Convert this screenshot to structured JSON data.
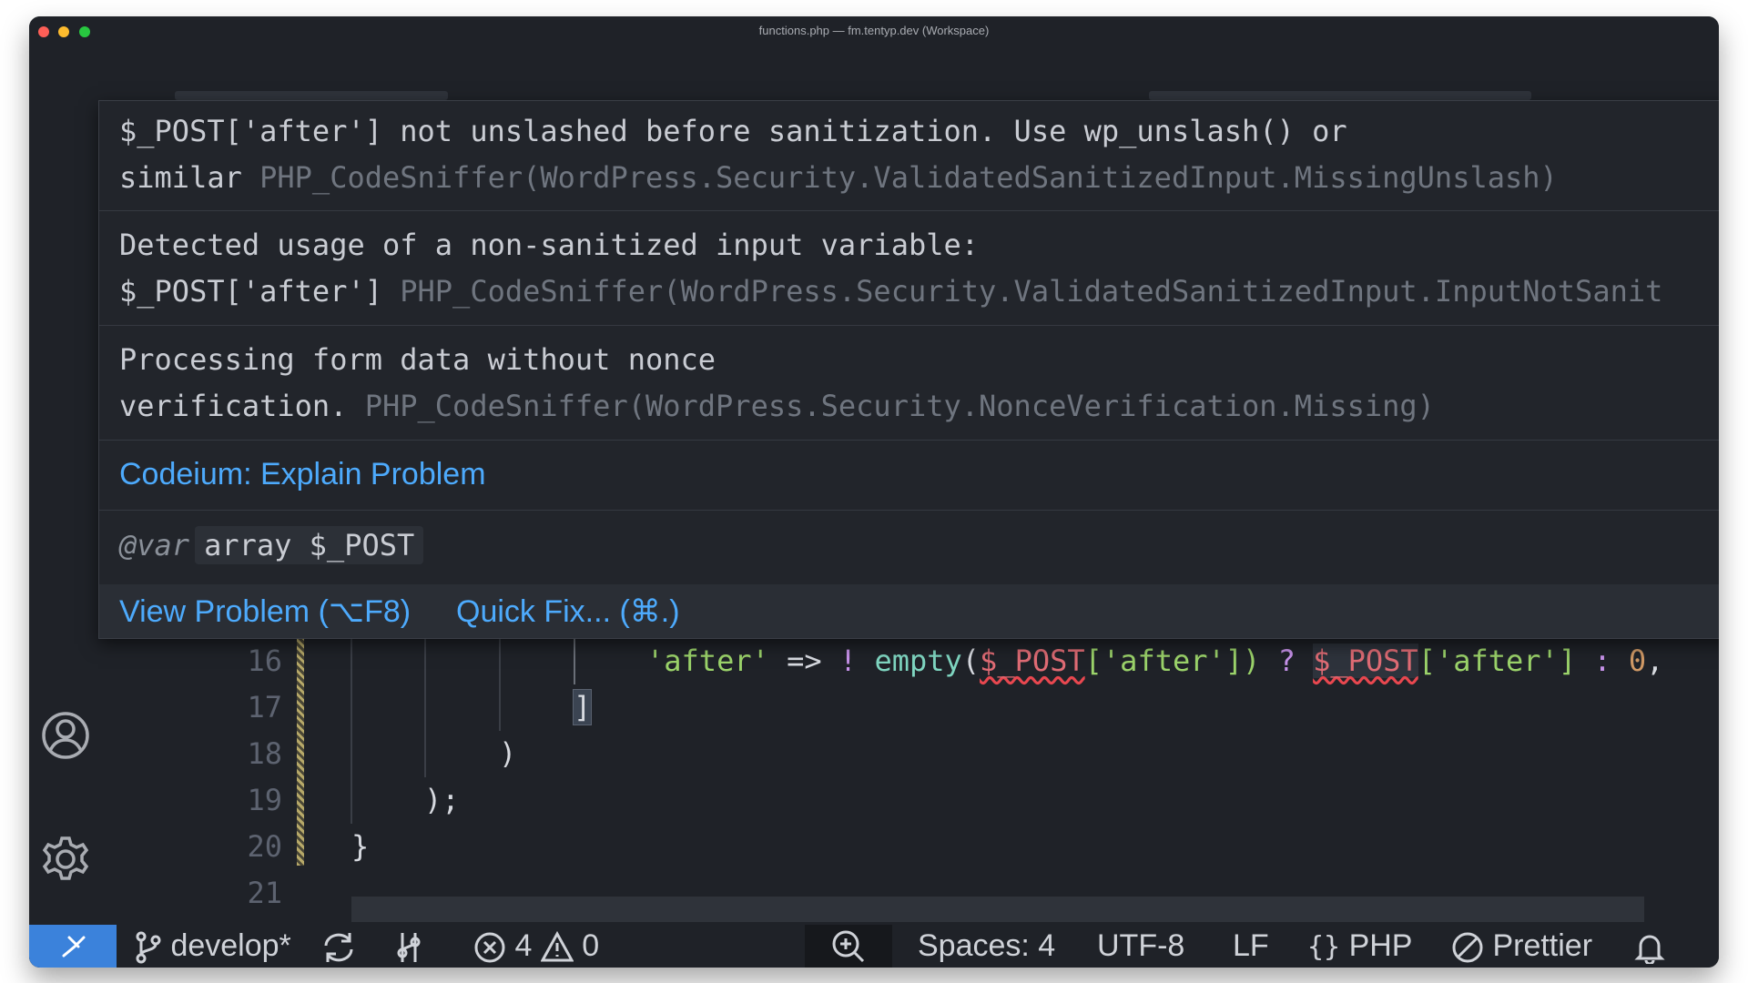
{
  "window": {
    "title": "functions.php — fm.tentyp.dev (Workspace)"
  },
  "hover": {
    "problems": [
      {
        "line1": "$_POST['after'] not unslashed before sanitization. Use wp_unslash() or",
        "line2_msg": "similar",
        "line2_src": "PHP_CodeSniffer(WordPress.Security.ValidatedSanitizedInput.MissingUnslash)"
      },
      {
        "line1": "Detected usage of a non-sanitized input variable:",
        "line2_msg": "$_POST['after']",
        "line2_src": "PHP_CodeSniffer(WordPress.Security.ValidatedSanitizedInput.InputNotSanit"
      },
      {
        "line1": "Processing form data without nonce",
        "line2_msg": "verification.",
        "line2_src": "PHP_CodeSniffer(WordPress.Security.NonceVerification.Missing)"
      }
    ],
    "codeium_action": "Codeium: Explain Problem",
    "vardoc": {
      "tag": "@var",
      "type": "array $_POST"
    },
    "footer": {
      "view_problem": "View Problem (⌥F8)",
      "quick_fix": "Quick Fix... (⌘.)"
    }
  },
  "editor": {
    "line_numbers": [
      "16",
      "17",
      "18",
      "19",
      "20",
      "21"
    ],
    "line16": {
      "key": "'after'",
      "arrow": " => ",
      "not": "! ",
      "fn": "empty",
      "open": "(",
      "var1": "$_POST",
      "idx1": "['after'])",
      "q": " ? ",
      "var2": "$_POST",
      "idx2": "['after']",
      "colon": " : ",
      "zero": "0",
      "comma": ","
    },
    "line17": "]",
    "line18": ")",
    "line19": ");",
    "line20": "}"
  },
  "statusbar": {
    "branch": "develop*",
    "errors": "4",
    "warnings": "0",
    "spaces": "Spaces: 4",
    "encoding": "UTF-8",
    "eol": "LF",
    "language": "PHP",
    "formatter": "Prettier"
  },
  "colors": {
    "accent": "#4daafc",
    "remote": "#3b82db",
    "error": "#e8474f",
    "string": "#9bd36a"
  }
}
